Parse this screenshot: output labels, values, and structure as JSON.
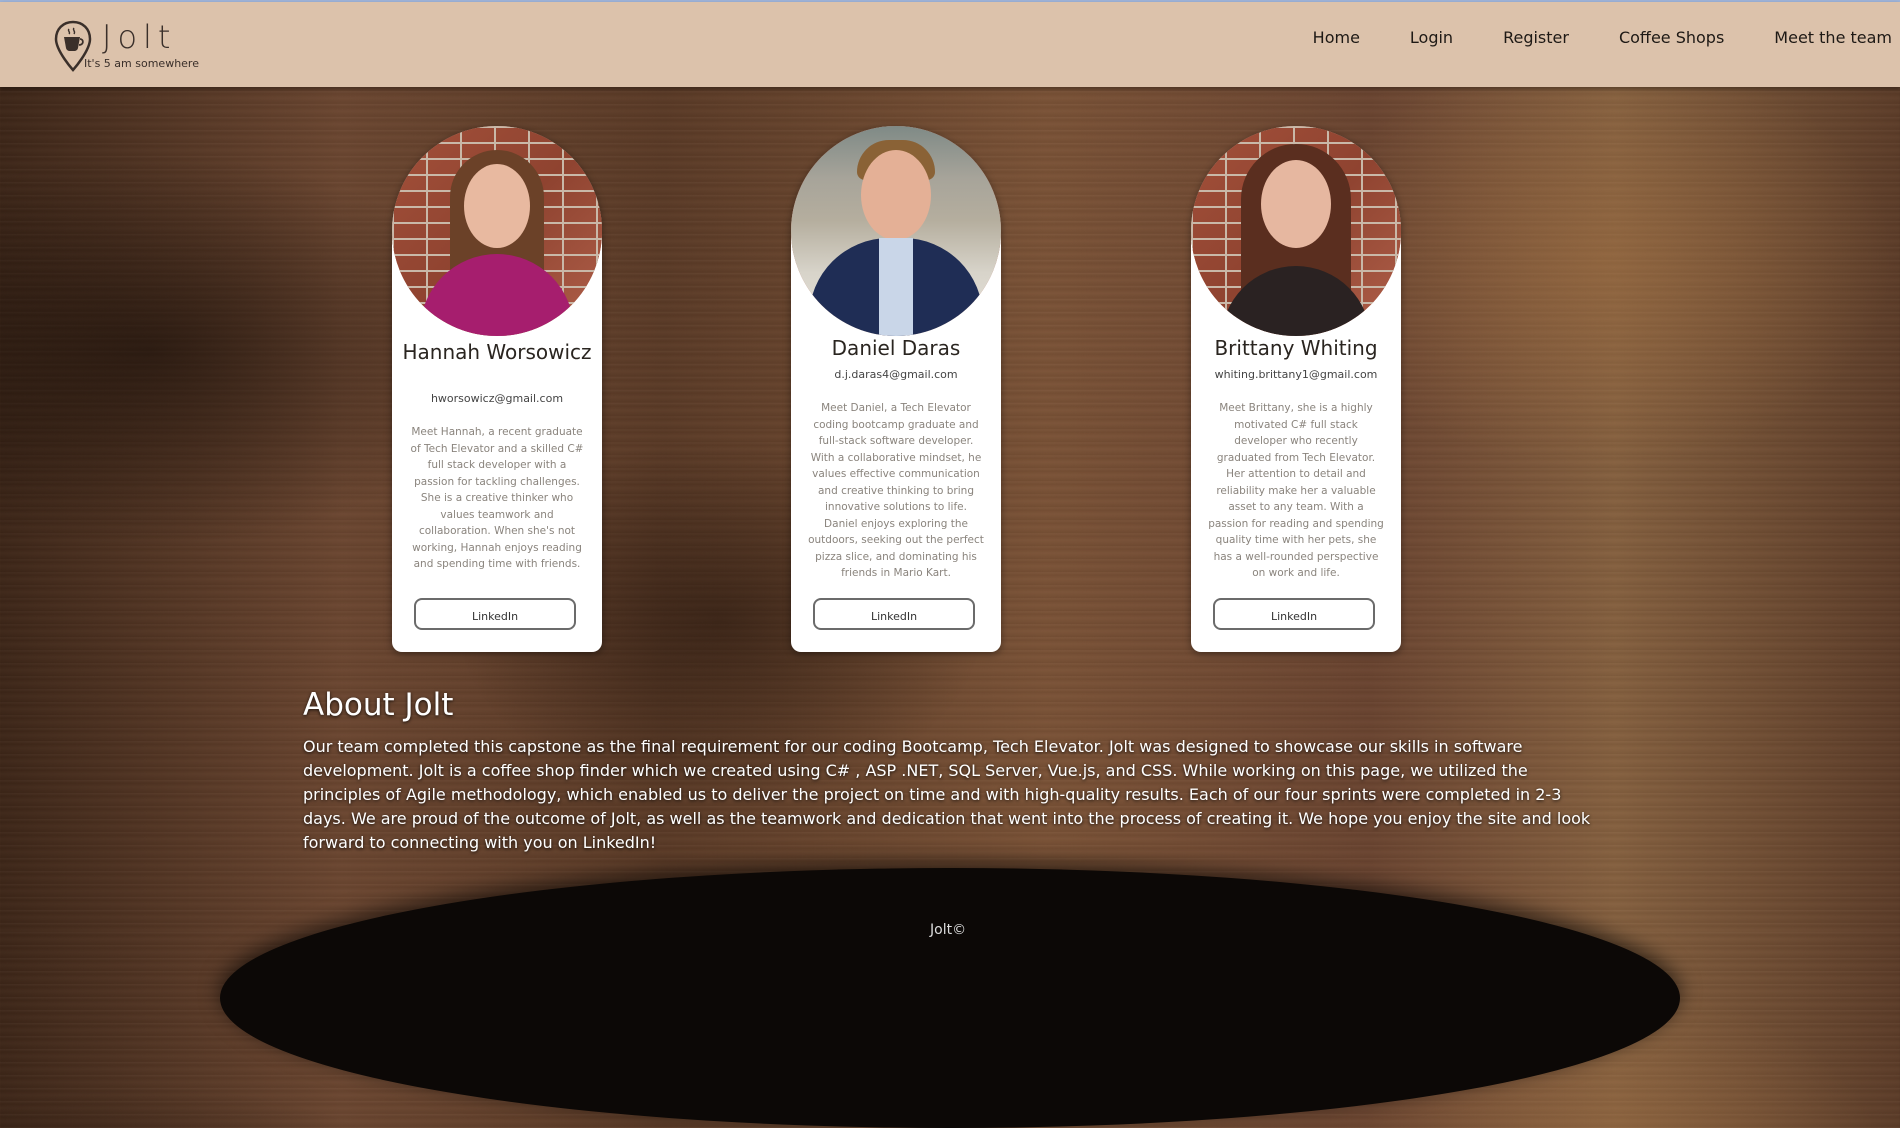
{
  "brand": {
    "name": "Jolt",
    "tagline": "It's 5 am somewhere"
  },
  "nav": {
    "items": [
      "Home",
      "Login",
      "Register",
      "Coffee Shops",
      "Meet the team"
    ]
  },
  "team": [
    {
      "name": "Hannah Worsowicz",
      "email": "hworsowicz@gmail.com",
      "bio": "Meet Hannah, a recent graduate of Tech Elevator and a skilled C# full stack developer with a passion for tackling challenges. She is a creative thinker who values teamwork and collaboration. When she's not working, Hannah enjoys reading and spending time with friends.",
      "link_label": "LinkedIn"
    },
    {
      "name": "Daniel Daras",
      "email": "d.j.daras4@gmail.com",
      "bio": "Meet Daniel, a Tech Elevator coding bootcamp graduate and full-stack software developer. With a collaborative mindset, he values effective communication and creative thinking to bring innovative solutions to life. Daniel enjoys exploring the outdoors, seeking out the perfect pizza slice, and dominating his friends in Mario Kart.",
      "link_label": "LinkedIn"
    },
    {
      "name": "Brittany Whiting",
      "email": "whiting.brittany1@gmail.com",
      "bio": "Meet Brittany, she is a highly motivated C# full stack developer who recently graduated from Tech Elevator. Her attention to detail and reliability make her a valuable asset to any team. With a passion for reading and spending quality time with her pets, she has a well-rounded perspective on work and life.",
      "link_label": "LinkedIn"
    }
  ],
  "about": {
    "title": "About Jolt",
    "text": "Our team completed this capstone as the final requirement for our coding Bootcamp, Tech Elevator. Jolt was designed to showcase our skills in software development. Jolt is a coffee shop finder which we created using C# , ASP .NET, SQL Server, Vue.js, and CSS. While working on this page, we utilized the principles of Agile methodology, which enabled us to deliver the project on time and with high-quality results. Each of our four sprints were completed in 2-3 days. We are proud of the outcome of Jolt, as well as the teamwork and dedication that went into the process of creating it. We hope you enjoy the site and look forward to connecting with you on LinkedIn!"
  },
  "footer": {
    "text": "Jolt©"
  },
  "colors": {
    "header_bg": "#dcc2ab",
    "card_bg": "#ffffff",
    "footer_bg": "#0c0806"
  }
}
